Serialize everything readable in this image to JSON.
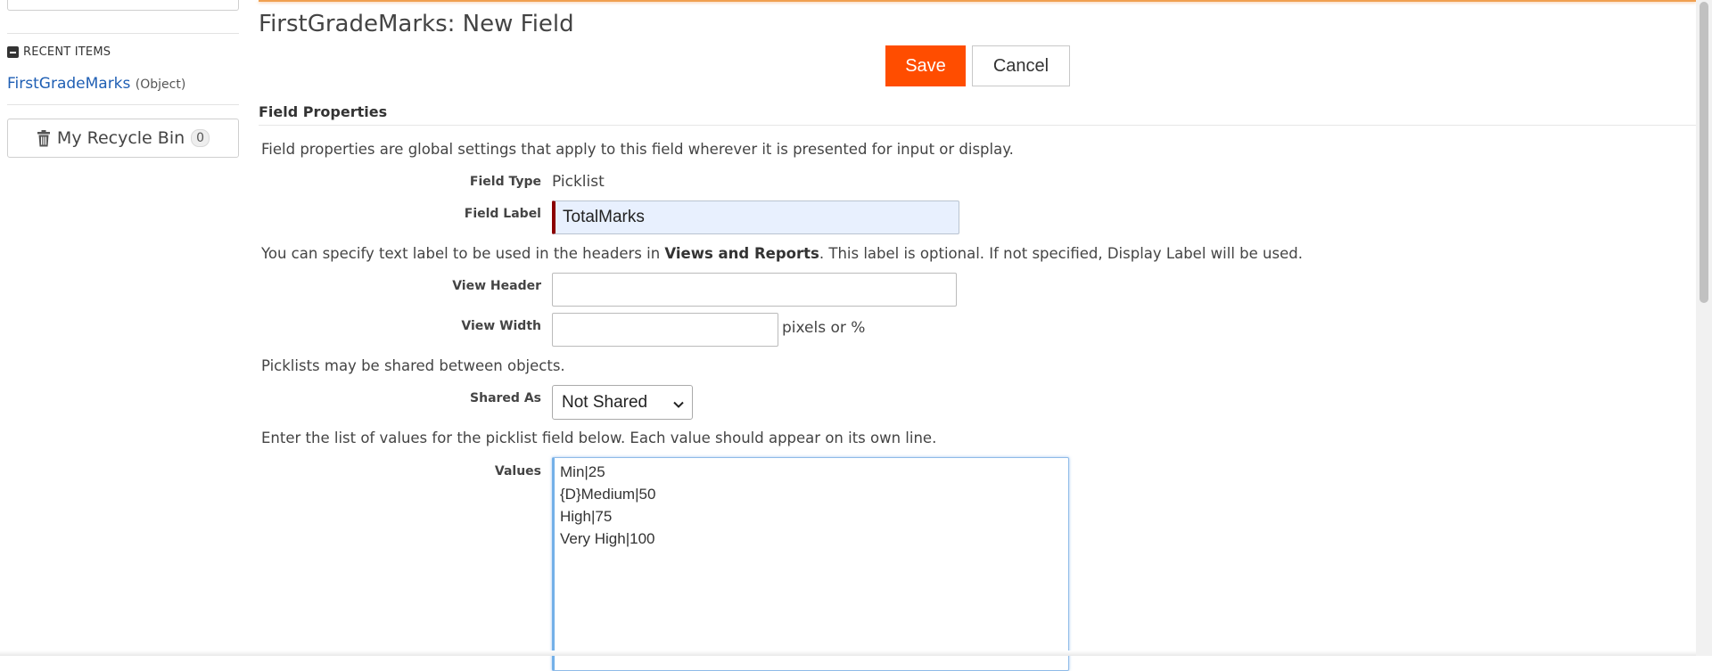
{
  "sidebar": {
    "recent_items": {
      "header": "RECENT ITEMS",
      "items": [
        {
          "name": "FirstGradeMarks",
          "type": "(Object)"
        }
      ]
    },
    "recycle_bin": {
      "label": "My Recycle Bin",
      "count": "0"
    }
  },
  "page": {
    "title": "FirstGradeMarks: New Field",
    "save_label": "Save",
    "cancel_label": "Cancel"
  },
  "field_properties": {
    "section_title": "Field Properties",
    "intro": "Field properties are global settings that apply to this field wherever it is presented for input or display.",
    "field_type_label": "Field Type",
    "field_type_value": "Picklist",
    "field_label_label": "Field Label",
    "field_label_value": "TotalMarks",
    "view_note_before": "You can specify text label to be used in the headers in ",
    "view_note_bold": "Views and Reports",
    "view_note_after": ". This label is optional. If not specified, Display Label will be used.",
    "view_header_label": "View Header",
    "view_header_value": "",
    "view_width_label": "View Width",
    "view_width_value": "",
    "view_width_unit": "pixels or %",
    "shared_note": "Picklists may be shared between objects.",
    "shared_as_label": "Shared As",
    "shared_as_value": "Not Shared",
    "values_note": "Enter the list of values for the picklist field below. Each value should appear on its own line.",
    "values_label": "Values",
    "values_text": "Min|25\n{D}Medium|50\nHigh|75\nVery High|100"
  },
  "colors": {
    "save_button": "#ff4d00",
    "link": "#1f5fb4",
    "required_marker": "#8b0000",
    "top_accent": "#f0a050"
  },
  "icons": {
    "recent_toggle": "minus-square-icon",
    "recycle": "trash-icon",
    "select": "chevron-down-icon"
  }
}
